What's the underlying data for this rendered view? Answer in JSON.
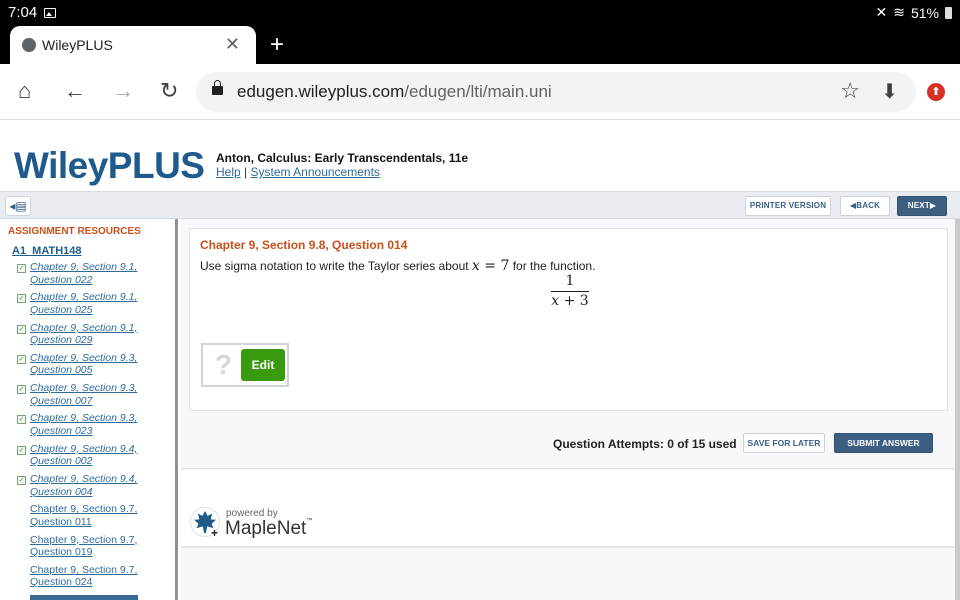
{
  "status_bar": {
    "time": "7:04",
    "battery": "51%"
  },
  "browser": {
    "tab_title": "WileyPLUS",
    "url_host": "edugen.wileyplus.com",
    "url_path": "/edugen/lti/main.uni"
  },
  "header": {
    "logo": "WileyPLUS",
    "book_title": "Anton, Calculus: Early Transcendentals, 11e",
    "help_link": "Help",
    "separator": "|",
    "announcements_link": "System Announcements"
  },
  "topbar": {
    "printer_version": "PRINTER VERSION",
    "back": "◀BACK",
    "next": "NEXT▶"
  },
  "sidebar": {
    "title": "ASSIGNMENT RESOURCES",
    "assignment": "A1_MATH148",
    "items": [
      {
        "line1": "Chapter 9, Section 9.1,",
        "line2": "Question 022",
        "done": true
      },
      {
        "line1": "Chapter 9, Section 9.1,",
        "line2": "Question 025",
        "done": true
      },
      {
        "line1": "Chapter 9, Section 9.1,",
        "line2": "Question 029",
        "done": true
      },
      {
        "line1": "Chapter 9, Section 9.3,",
        "line2": "Question 005",
        "done": true
      },
      {
        "line1": "Chapter 9, Section 9.3,",
        "line2": "Question 007",
        "done": true
      },
      {
        "line1": "Chapter 9, Section 9.3,",
        "line2": "Question 023",
        "done": true
      },
      {
        "line1": "Chapter 9, Section 9.4,",
        "line2": "Question 002",
        "done": true
      },
      {
        "line1": "Chapter 9, Section 9.4,",
        "line2": "Question 004",
        "done": true
      },
      {
        "line1": "Chapter 9, Section 9.7,",
        "line2": "Question 011",
        "done": false
      },
      {
        "line1": "Chapter 9, Section 9.7,",
        "line2": "Question 019",
        "done": false
      },
      {
        "line1": "Chapter 9, Section 9.7,",
        "line2": "Question 024",
        "done": false
      }
    ]
  },
  "question": {
    "title": "Chapter 9, Section 9.8, Question 014",
    "text_before": "Use sigma notation to write the Taylor series about ",
    "math_var": "x",
    "math_eq": " = 7",
    "text_after": " for the function.",
    "fraction_numerator": "1",
    "fraction_denominator": "x + 3",
    "answer_placeholder": "?",
    "edit_button": "Edit"
  },
  "actions": {
    "attempts": "Question Attempts: 0 of 15 used",
    "save_for_later": "SAVE FOR LATER",
    "submit_answer": "SUBMIT ANSWER"
  },
  "footer": {
    "powered_by": "powered by",
    "brand": "MapleNet",
    "trademark": "™"
  }
}
